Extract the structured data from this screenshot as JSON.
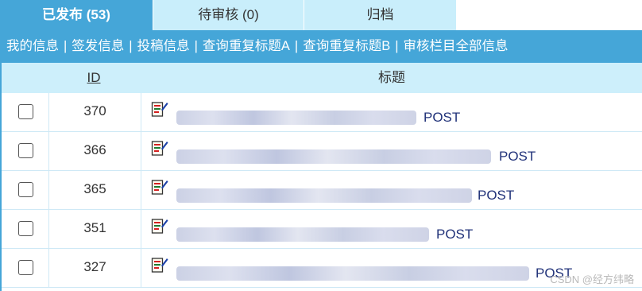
{
  "tabs": [
    {
      "label": "已发布 (53)"
    },
    {
      "label": "待审核 (0)"
    },
    {
      "label": "归档"
    }
  ],
  "nav": {
    "items": [
      "我的信息",
      "签发信息",
      "投稿信息",
      "查询重复标题A",
      "查询重复标题B",
      "审核栏目全部信息"
    ],
    "separator": "|"
  },
  "table": {
    "columns": {
      "id": "ID",
      "title": "标题"
    },
    "rows": [
      {
        "id": "370",
        "title_suffix": "POST"
      },
      {
        "id": "366",
        "title_suffix": "POST"
      },
      {
        "id": "365",
        "title_suffix": "POST"
      },
      {
        "id": "351",
        "title_suffix": "POST"
      },
      {
        "id": "327",
        "title_suffix": "POST"
      }
    ]
  },
  "watermark": "CSDN @经方纬略",
  "colors": {
    "accent": "#45a6d8",
    "header_bg": "#cdeffb",
    "link": "#22337a"
  }
}
